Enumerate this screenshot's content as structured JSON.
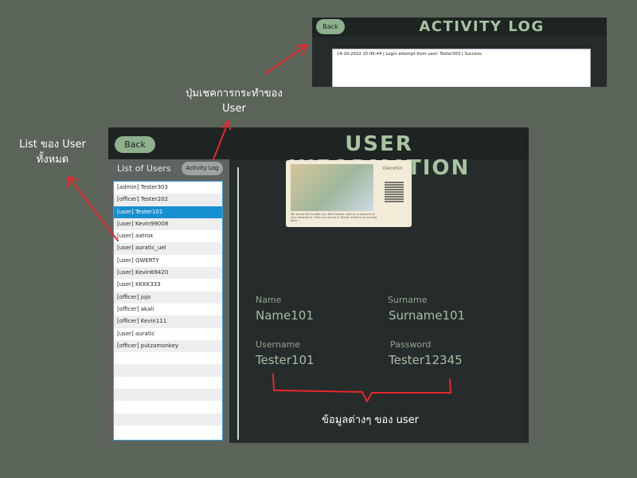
{
  "annotations": {
    "user_list_note": "List ของ User ทั้งหมด",
    "activity_button_note": "ปุ่มเชคการกระทำของ User",
    "user_info_note": "ข้อมูลต่างๆ ของ user"
  },
  "activity_log_window": {
    "back_label": "Back",
    "title": "ACTIVITY LOG",
    "entries": [
      "14-10-2022 15:45:44 | Login attempt from user: Tester303 | Success."
    ]
  },
  "user_info_window": {
    "back_label": "Back",
    "title": "USER INFORMATION",
    "sidebar": {
      "title": "List of Users",
      "activity_log_button": "Activity Log",
      "selected_index": 2,
      "users": [
        "[admin] Tester303",
        "[officer] Tester202",
        "[user] Tester101",
        "[user] Kevin99008",
        "[user] aatrox",
        "[user] auratic_uel",
        "[user] QWERTY",
        "[user] Kevin69420",
        "[user] KKKK333",
        "[officer] jojo",
        "[officer] akali",
        "[officer] Kevin111",
        "[user] auratic",
        "[officer] putzamonkey"
      ]
    },
    "card": {
      "logo_text": "Genshin",
      "caption": "We would like to offer you this traveler card as a souvenir of your adventure. Once you arrive in Teyvat, there is no turning back..."
    },
    "fields": {
      "name_label": "Name",
      "name_value": "Name101",
      "surname_label": "Surname",
      "surname_value": "Surname101",
      "username_label": "Username",
      "username_value": "Tester101",
      "password_label": "Password",
      "password_value": "Tester12345"
    }
  },
  "colors": {
    "page_bg": "#5a6458",
    "window_bg": "#262c2b",
    "accent_green": "#8fb08d",
    "title_green": "#a8c3a2",
    "selection_blue": "#1790d1",
    "annotation_red": "#e8262a"
  }
}
